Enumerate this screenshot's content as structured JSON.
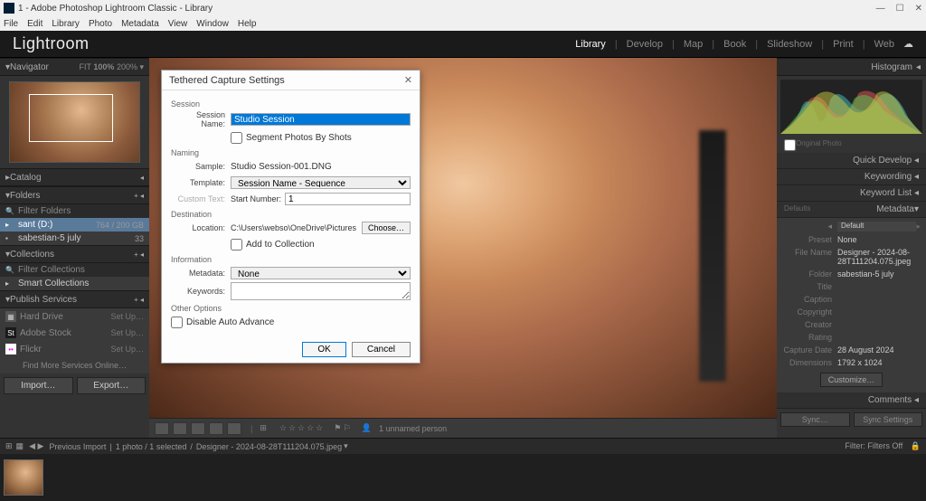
{
  "titlebar": {
    "text": "1 - Adobe Photoshop Lightroom Classic - Library"
  },
  "menubar": [
    "File",
    "Edit",
    "Library",
    "Photo",
    "Metadata",
    "View",
    "Window",
    "Help"
  ],
  "header": {
    "logo": "Lightroom",
    "modules": [
      "Library",
      "Develop",
      "Map",
      "Book",
      "Slideshow",
      "Print",
      "Web"
    ],
    "active_module": "Library"
  },
  "left": {
    "navigator": {
      "title": "Navigator",
      "fit": "FIT",
      "pct": "100%",
      "zoom": "200%"
    },
    "catalog": "Catalog",
    "folders": {
      "title": "Folders",
      "filter": "Filter Folders",
      "items": [
        {
          "label": "sant (D:)",
          "meta": "764 / 200 GB",
          "icon": "▸"
        },
        {
          "label": "sabestian-5 july",
          "count": "33",
          "icon": "▪"
        }
      ]
    },
    "collections": {
      "title": "Collections",
      "filter": "Filter Collections",
      "smart": "Smart Collections"
    },
    "publish": {
      "title": "Publish Services",
      "items": [
        {
          "service": "Hard Drive",
          "setup": "Set Up…",
          "badge": "▦",
          "color": "#555"
        },
        {
          "service": "Adobe Stock",
          "setup": "Set Up…",
          "badge": "St",
          "color": "#1a1a1a"
        },
        {
          "service": "Flickr",
          "setup": "Set Up…",
          "badge": "••",
          "color": "#fff"
        }
      ],
      "more": "Find More Services Online…"
    },
    "import": "Import…",
    "export": "Export…"
  },
  "toolbar": {
    "person": "1 unnamed person"
  },
  "right": {
    "histogram": "Histogram",
    "original": "Original Photo",
    "sections": [
      "Quick Develop",
      "Keywording",
      "Keyword List",
      "Metadata"
    ],
    "defaults_label": "Defaults",
    "default_dropdown": "Default",
    "preset_label": "Preset",
    "preset_value": "None",
    "metadata": [
      {
        "label": "File Name",
        "value": "Designer - 2024-08-28T111204.075.jpeg"
      },
      {
        "label": "Folder",
        "value": "sabestian-5 july"
      },
      {
        "label": "Title",
        "value": ""
      },
      {
        "label": "Caption",
        "value": ""
      },
      {
        "label": "Copyright",
        "value": ""
      },
      {
        "label": "Creator",
        "value": ""
      },
      {
        "label": "Rating",
        "value": ""
      },
      {
        "label": "Capture Date",
        "value": "28 August 2024"
      },
      {
        "label": "Dimensions",
        "value": "1792 x 1024"
      }
    ],
    "customize": "Customize…",
    "comments": "Comments",
    "sync": "Sync…",
    "sync_settings": "Sync Settings"
  },
  "filmstrip": {
    "nav": "Previous Import",
    "count": "1 photo / 1 selected",
    "file": "Designer - 2024-08-28T111204.075.jpeg",
    "filter_label": "Filter:",
    "filter_value": "Filters Off"
  },
  "dialog": {
    "title": "Tethered Capture Settings",
    "session_group": "Session",
    "session_name_label": "Session Name:",
    "session_name_value": "Studio Session",
    "segment": "Segment Photos By Shots",
    "naming_group": "Naming",
    "sample_label": "Sample:",
    "sample_value": "Studio Session-001.DNG",
    "template_label": "Template:",
    "template_value": "Session Name - Sequence",
    "custom_text_label": "Custom Text:",
    "start_number_label": "Start Number:",
    "start_number_value": "1",
    "destination_group": "Destination",
    "location_label": "Location:",
    "location_value": "C:\\Users\\webso\\OneDrive\\Pictures",
    "choose": "Choose…",
    "add_collection": "Add to Collection",
    "information_group": "Information",
    "metadata_label": "Metadata:",
    "metadata_value": "None",
    "keywords_label": "Keywords:",
    "other_group": "Other Options",
    "disable_advance": "Disable Auto Advance",
    "ok": "OK",
    "cancel": "Cancel"
  }
}
